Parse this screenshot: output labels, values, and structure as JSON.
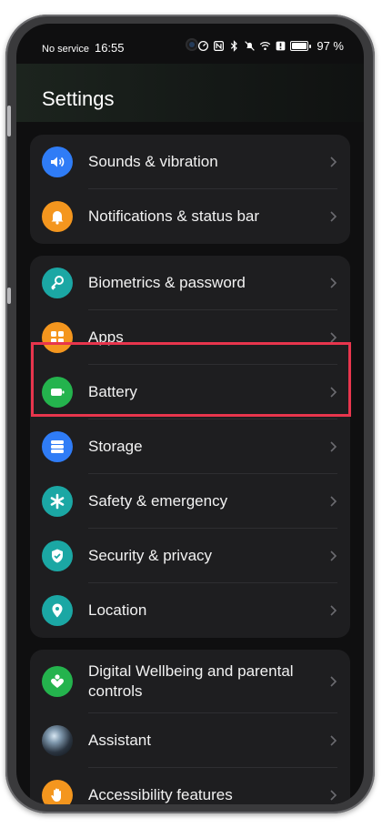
{
  "status_bar": {
    "carrier": "No service",
    "time": "16:55",
    "battery_percent": "97 %",
    "battery_level": 0.97,
    "icons": [
      "data-saver-icon",
      "nfc-icon",
      "bluetooth-icon",
      "mute-icon",
      "wifi-icon",
      "alert-icon",
      "battery-icon"
    ]
  },
  "page": {
    "title": "Settings"
  },
  "groups": [
    {
      "items": [
        {
          "label": "Sounds & vibration",
          "icon": "volume-icon",
          "color": "#2f7cf6"
        },
        {
          "label": "Notifications & status bar",
          "icon": "bell-icon",
          "color": "#f4961e"
        }
      ]
    },
    {
      "items": [
        {
          "label": "Biometrics & password",
          "icon": "key-icon",
          "color": "#1ba7a4"
        },
        {
          "label": "Apps",
          "icon": "apps-grid-icon",
          "color": "#f4961e"
        },
        {
          "label": "Battery",
          "icon": "battery-icon",
          "color": "#24b34d"
        },
        {
          "label": "Storage",
          "icon": "storage-icon",
          "color": "#2f7cf6"
        },
        {
          "label": "Safety & emergency",
          "icon": "asterisk-icon",
          "color": "#1ba7a4"
        },
        {
          "label": "Security & privacy",
          "icon": "shield-icon",
          "color": "#1ba7a4"
        },
        {
          "label": "Location",
          "icon": "location-pin-icon",
          "color": "#1ba7a4"
        }
      ]
    },
    {
      "items": [
        {
          "label": "Digital Wellbeing and parental controls",
          "icon": "wellbeing-icon",
          "color": "#24b34d"
        },
        {
          "label": "Assistant",
          "icon": "assistant-orb-icon",
          "color": "#2a3440"
        },
        {
          "label": "Accessibility features",
          "icon": "hand-icon",
          "color": "#f4961e"
        }
      ]
    }
  ],
  "highlight": {
    "target": "Battery",
    "color": "#e8354d"
  }
}
